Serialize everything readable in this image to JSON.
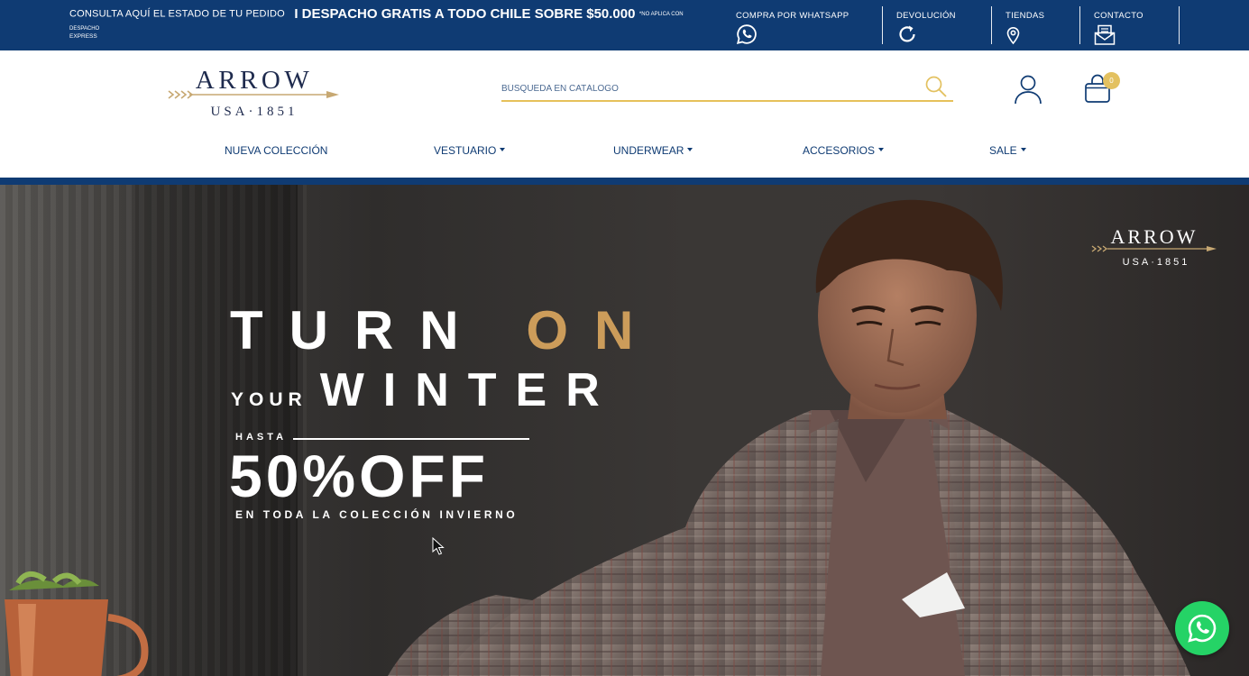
{
  "topbar": {
    "order_status": "CONSULTA AQUÍ EL ESTADO DE TU PEDIDO",
    "shipping": "I DESPACHO GRATIS A TODO CHILE SOBRE $50.000",
    "shipping_note": "*NO APLICA CON DESPACHO",
    "shipping_note_2": "EXPRESS",
    "links": [
      {
        "label": "COMPRA POR WHATSAPP",
        "icon": "whatsapp-icon"
      },
      {
        "label": "DEVOLUCIÓN",
        "icon": "refresh-icon"
      },
      {
        "label": "TIENDAS",
        "icon": "map-pin-icon"
      },
      {
        "label": "CONTACTO",
        "icon": "mail-icon"
      }
    ],
    "background_color": "#0f3b73"
  },
  "brand": {
    "name": "ARROW",
    "tagline": "USA·1851"
  },
  "search": {
    "placeholder": "BÚSQUEDA EN CATÁLOGO",
    "underline_color": "#e6c15a"
  },
  "cart": {
    "count": "0"
  },
  "nav": {
    "items": [
      {
        "label": "NUEVA COLECCIÓN",
        "dropdown": false
      },
      {
        "label": "VESTUARIO",
        "dropdown": true
      },
      {
        "label": "UNDERWEAR",
        "dropdown": true
      },
      {
        "label": "ACCESORIOS",
        "dropdown": true
      },
      {
        "label": "SALE",
        "dropdown": true
      }
    ]
  },
  "hero": {
    "line1_white": "TURN",
    "line1_gold": "ON",
    "line2_small": "YOUR",
    "line2_big": "WINTER",
    "hasta": "HASTA",
    "discount": "50%OFF",
    "subtitle": "EN TODA LA COLECCIÓN INVIERNO",
    "gold_color": "#cc9c5a"
  }
}
